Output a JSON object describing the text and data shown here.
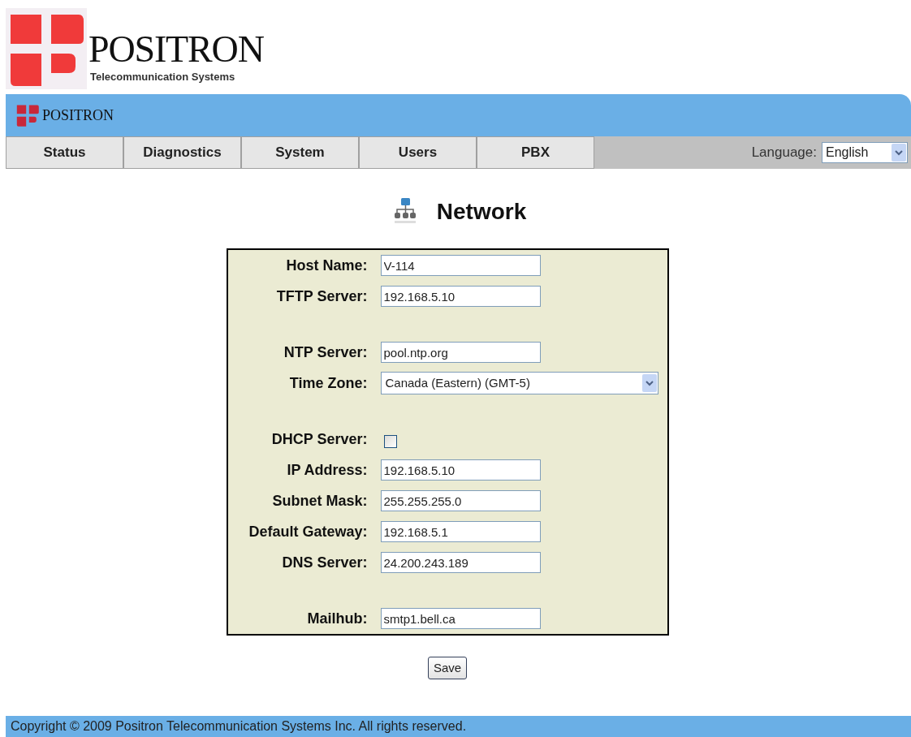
{
  "header": {
    "brand": "POSITRON",
    "tagline": "Telecommunication Systems"
  },
  "banner": {
    "brand": "POSITRON"
  },
  "tabs": [
    {
      "label": "Status",
      "selected": false
    },
    {
      "label": "Diagnostics",
      "selected": false
    },
    {
      "label": "System",
      "selected": false
    },
    {
      "label": "Users",
      "selected": false
    },
    {
      "label": "PBX",
      "selected": false
    }
  ],
  "language": {
    "label": "Language:",
    "value": "English"
  },
  "page_title": "Network",
  "form": [
    {
      "kind": "text",
      "label": "Host Name:",
      "value": "V-114"
    },
    {
      "kind": "text",
      "label": "TFTP Server:",
      "value": "192.168.5.10"
    },
    {
      "kind": "spacer"
    },
    {
      "kind": "text",
      "label": "NTP Server:",
      "value": "pool.ntp.org"
    },
    {
      "kind": "select",
      "label": "Time Zone:",
      "value": "Canada (Eastern) (GMT-5)"
    },
    {
      "kind": "spacer"
    },
    {
      "kind": "checkbox",
      "label": "DHCP Server:",
      "checked": false
    },
    {
      "kind": "text",
      "label": "IP Address:",
      "value": "192.168.5.10"
    },
    {
      "kind": "text",
      "label": "Subnet Mask:",
      "value": "255.255.255.0"
    },
    {
      "kind": "text",
      "label": "Default Gateway:",
      "value": "192.168.5.1"
    },
    {
      "kind": "text",
      "label": "DNS Server:",
      "value": "24.200.243.189"
    },
    {
      "kind": "spacer"
    },
    {
      "kind": "text",
      "label": "Mailhub:",
      "value": "smtp1.bell.ca"
    }
  ],
  "save_button": "Save",
  "footer": "Copyright © 2009 Positron Telecommunication Systems Inc. All rights reserved."
}
